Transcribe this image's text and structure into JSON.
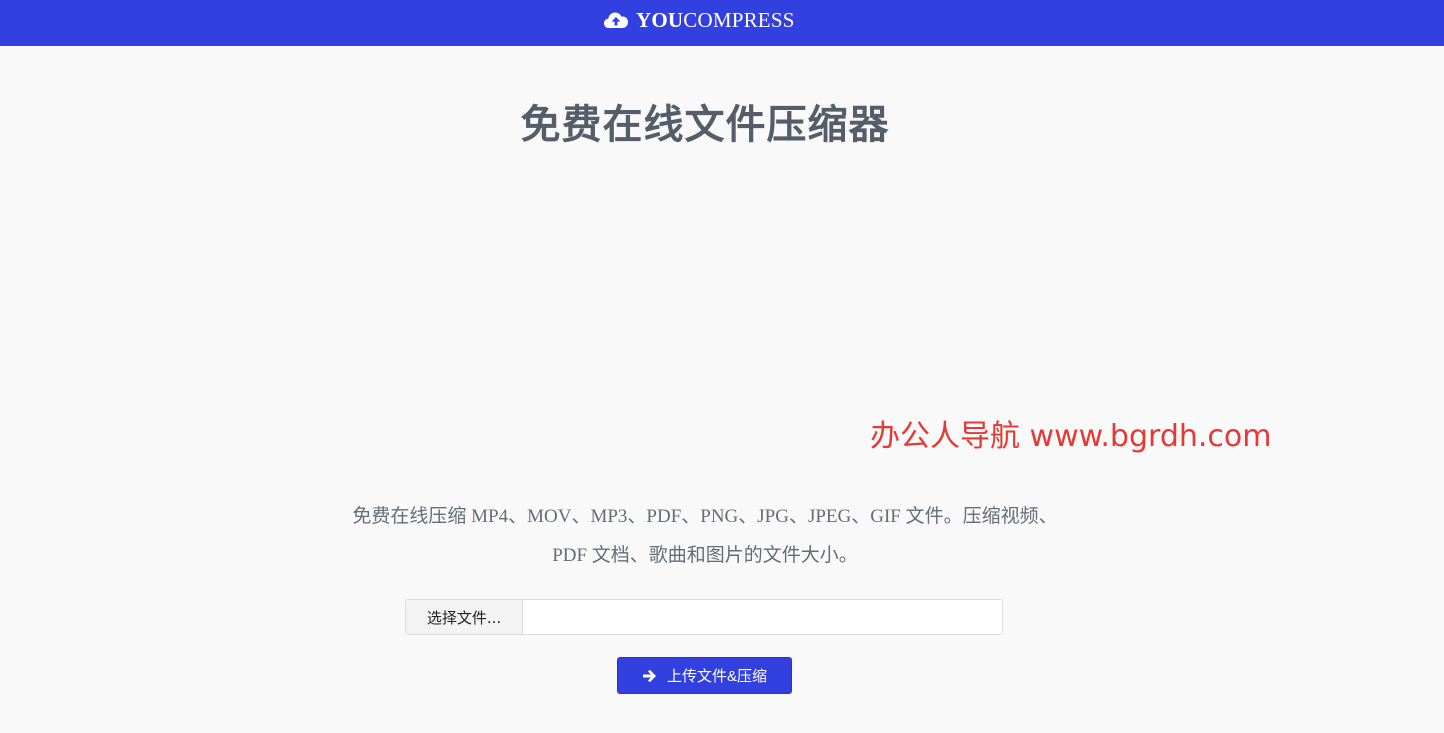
{
  "header": {
    "brand_bold": "YOU",
    "brand_rest": "COMPRESS",
    "icon": "cloud-upload-icon",
    "background_color": "#3340e0"
  },
  "main": {
    "title": "免费在线文件压缩器",
    "description": "免费在线压缩 MP4、MOV、MP3、PDF、PNG、JPG、JPEG、GIF 文件。压缩视频、PDF 文档、歌曲和图片的文件大小。",
    "file_input": {
      "button_label": "选择文件...",
      "filename": ""
    },
    "submit": {
      "label": "上传文件&压缩",
      "icon": "arrow-right-icon"
    }
  },
  "watermark": {
    "text": "办公人导航 www.bgrdh.com",
    "color": "#e53935"
  }
}
